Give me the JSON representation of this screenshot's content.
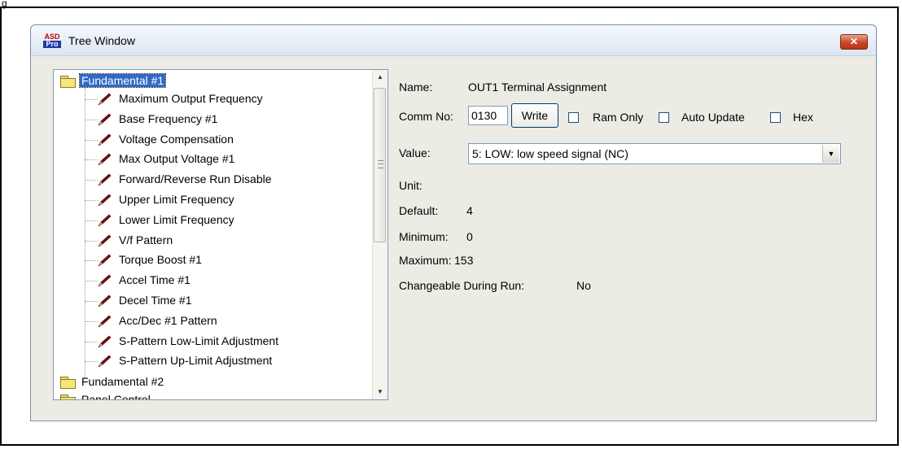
{
  "figure_label": "g",
  "window": {
    "title": "Tree Window",
    "icon_lines": [
      "ASD",
      "Pro"
    ],
    "close_label": "✕"
  },
  "tree": {
    "groups": [
      {
        "label": "Fundamental #1",
        "selected": true
      },
      {
        "label": "Fundamental #2",
        "selected": false
      },
      {
        "label": "Panel Control",
        "selected": false
      }
    ],
    "items": [
      "Maximum Output Frequency",
      "Base Frequency #1",
      "Voltage Compensation",
      "Max Output Voltage #1",
      "Forward/Reverse Run Disable",
      "Upper Limit Frequency",
      "Lower Limit Frequency",
      "V/f Pattern",
      "Torque Boost #1",
      "Accel Time #1",
      "Decel Time #1",
      "Acc/Dec #1 Pattern",
      "S-Pattern Low-Limit Adjustment",
      "S-Pattern Up-Limit Adjustment"
    ],
    "item_icon": "pencil-icon",
    "group_icon": "folder-icon"
  },
  "details": {
    "name_label": "Name:",
    "name_value": "OUT1 Terminal Assignment",
    "comm_label": "Comm No:",
    "comm_value": "0130",
    "write_label": "Write",
    "ram_only_label": "Ram Only",
    "auto_update_label": "Auto Update",
    "hex_label": "Hex",
    "value_label": "Value:",
    "value_selected": "5: LOW: low speed signal (NC)",
    "unit_label": "Unit:",
    "unit_value": "",
    "default_label": "Default:",
    "default_value": "4",
    "minimum_label": "Minimum:",
    "minimum_value": "0",
    "maximum_label": "Maximum:",
    "maximum_value": "153",
    "changeable_label": "Changeable During Run:",
    "changeable_value": "No"
  },
  "colors": {
    "selection": "#316ac5",
    "window_bg": "#ecebe4",
    "close_button": "#c9462a"
  }
}
